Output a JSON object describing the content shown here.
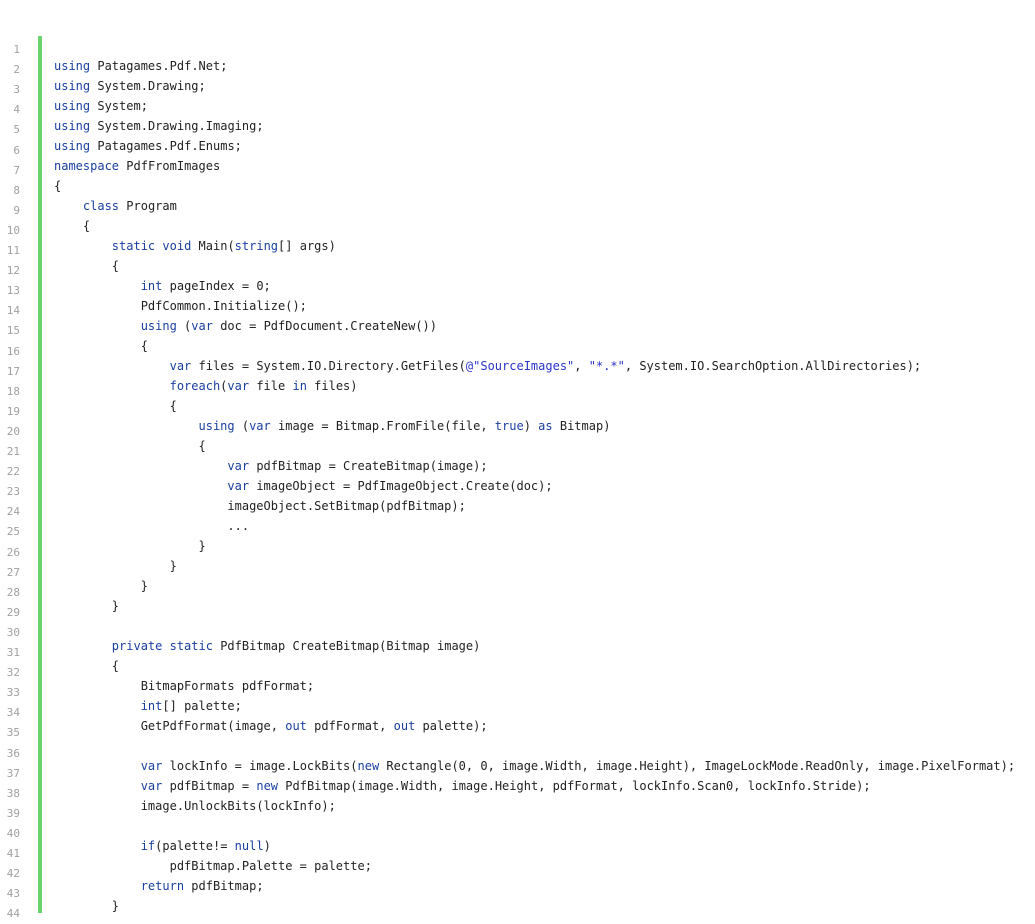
{
  "code": {
    "line_numbers": [
      "1",
      "2",
      "3",
      "4",
      "5",
      "6",
      "7",
      "8",
      "9",
      "10",
      "11",
      "12",
      "13",
      "14",
      "15",
      "16",
      "17",
      "18",
      "19",
      "20",
      "21",
      "22",
      "23",
      "24",
      "25",
      "26",
      "27",
      "28",
      "29",
      "30",
      "31",
      "32",
      "33",
      "34",
      "35",
      "36",
      "37",
      "38",
      "39",
      "40",
      "41",
      "42",
      "43",
      "44"
    ],
    "lines": [
      "",
      "using Patagames.Pdf.Net;",
      "using System.Drawing;",
      "using System;",
      "using System.Drawing.Imaging;",
      "using Patagames.Pdf.Enums;",
      "namespace PdfFromImages",
      "{",
      "    class Program",
      "    {",
      "        static void Main(string[] args)",
      "        {",
      "            int pageIndex = 0;",
      "            PdfCommon.Initialize();",
      "            using (var doc = PdfDocument.CreateNew())",
      "            {",
      "                var files = System.IO.Directory.GetFiles(@\"SourceImages\", \"*.*\", System.IO.SearchOption.AllDirectories);",
      "                foreach(var file in files)",
      "                {",
      "                    using (var image = Bitmap.FromFile(file, true) as Bitmap)",
      "                    {",
      "                        var pdfBitmap = CreateBitmap(image);",
      "                        var imageObject = PdfImageObject.Create(doc);",
      "                        imageObject.SetBitmap(pdfBitmap);",
      "                        ...",
      "                    }",
      "                }",
      "            }",
      "        }",
      "",
      "        private static PdfBitmap CreateBitmap(Bitmap image)",
      "        {",
      "            BitmapFormats pdfFormat;",
      "            int[] palette;",
      "            GetPdfFormat(image, out pdfFormat, out palette);",
      "",
      "            var lockInfo = image.LockBits(new Rectangle(0, 0, image.Width, image.Height), ImageLockMode.ReadOnly, image.PixelFormat);",
      "            var pdfBitmap = new PdfBitmap(image.Width, image.Height, pdfFormat, lockInfo.Scan0, lockInfo.Stride);",
      "            image.UnlockBits(lockInfo);",
      "",
      "            if(palette!= null)",
      "                pdfBitmap.Palette = palette;",
      "            return pdfBitmap;",
      "        }"
    ],
    "colors": {
      "keyword": "#1a3fa0",
      "string": "#2a33c8",
      "text": "#222222",
      "line_number": "#a0a0a0",
      "gutter_bar": "#6cd36c"
    }
  }
}
